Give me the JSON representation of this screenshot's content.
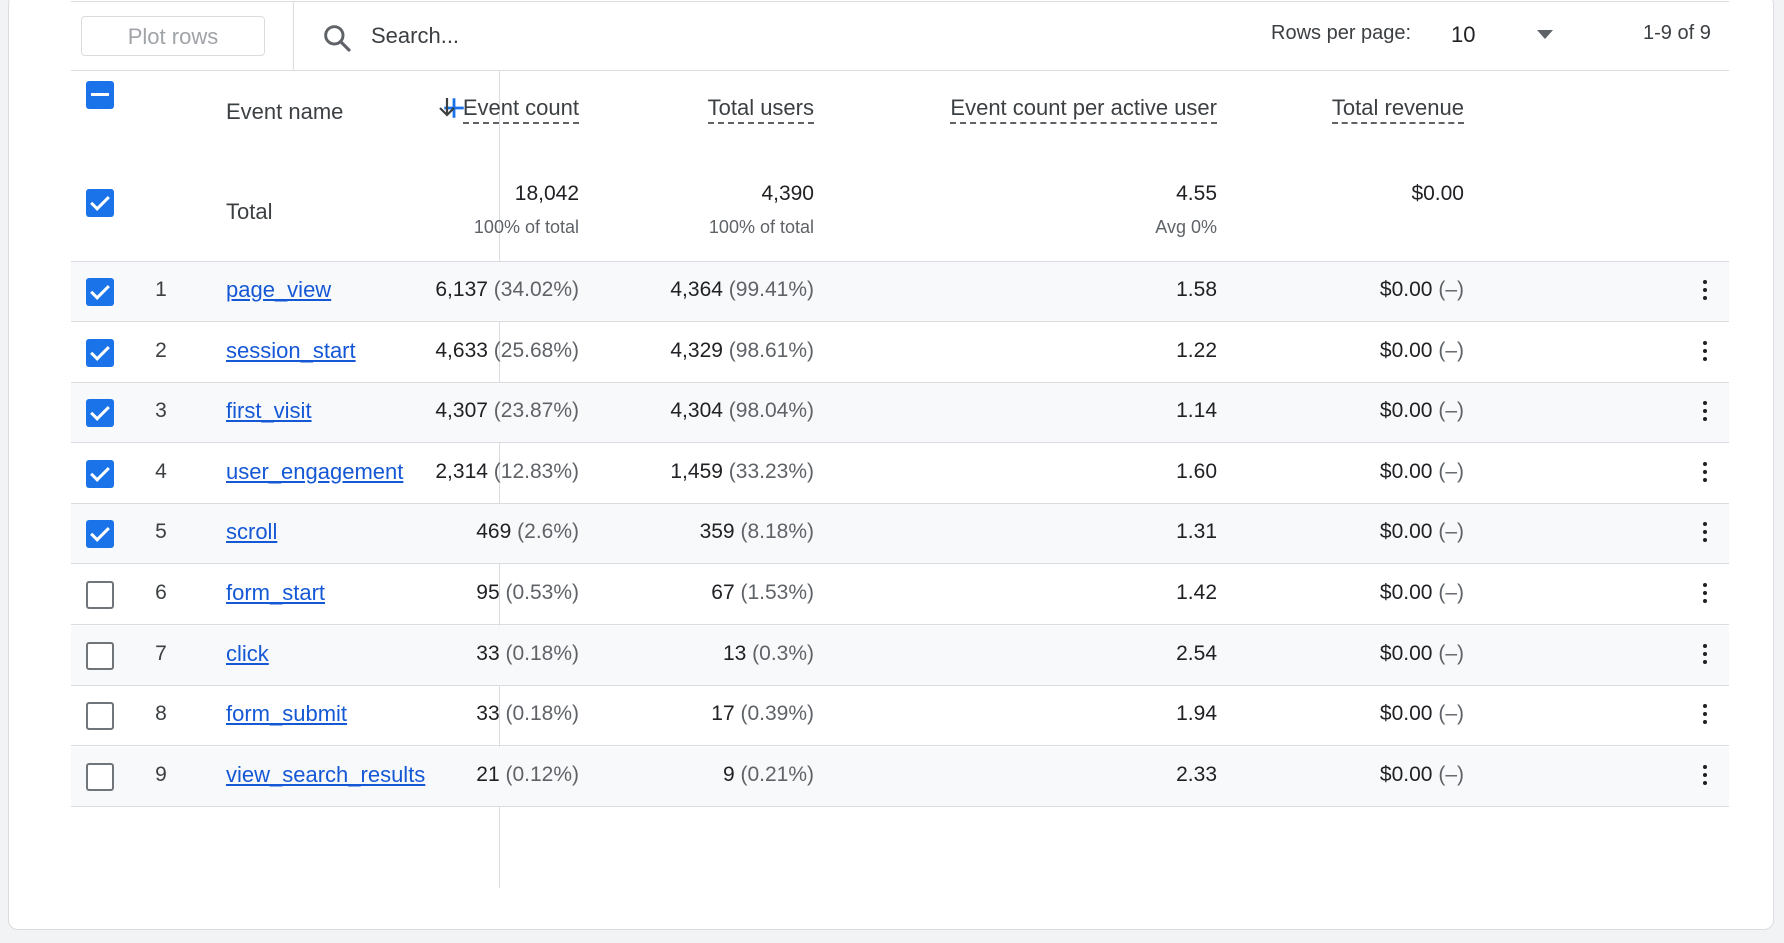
{
  "toolbar": {
    "plot_rows_label": "Plot rows",
    "search_placeholder": "Search...",
    "rows_per_page_label": "Rows per page:",
    "rows_per_page_value": "10",
    "pagination_text": "1-9 of 9"
  },
  "table": {
    "header": {
      "event_name": "Event name",
      "event_count": "Event count",
      "total_users": "Total users",
      "event_count_per_active_user": "Event count per active user",
      "total_revenue": "Total revenue"
    },
    "total": {
      "label": "Total",
      "event_count": "18,042",
      "event_count_sub": "100% of total",
      "total_users": "4,390",
      "total_users_sub": "100% of total",
      "event_count_per_active_user": "4.55",
      "event_count_per_active_user_sub": "Avg 0%",
      "total_revenue": "$0.00"
    },
    "rows": [
      {
        "index": "1",
        "name": "page_view",
        "checked": true,
        "event_count": "6,137",
        "event_count_pct": "(34.02%)",
        "total_users": "4,364",
        "total_users_pct": "(99.41%)",
        "epu": "1.58",
        "revenue": "$0.00",
        "revenue_pct": "(–)"
      },
      {
        "index": "2",
        "name": "session_start",
        "checked": true,
        "event_count": "4,633",
        "event_count_pct": "(25.68%)",
        "total_users": "4,329",
        "total_users_pct": "(98.61%)",
        "epu": "1.22",
        "revenue": "$0.00",
        "revenue_pct": "(–)"
      },
      {
        "index": "3",
        "name": "first_visit",
        "checked": true,
        "event_count": "4,307",
        "event_count_pct": "(23.87%)",
        "total_users": "4,304",
        "total_users_pct": "(98.04%)",
        "epu": "1.14",
        "revenue": "$0.00",
        "revenue_pct": "(–)"
      },
      {
        "index": "4",
        "name": "user_engagement",
        "checked": true,
        "event_count": "2,314",
        "event_count_pct": "(12.83%)",
        "total_users": "1,459",
        "total_users_pct": "(33.23%)",
        "epu": "1.60",
        "revenue": "$0.00",
        "revenue_pct": "(–)"
      },
      {
        "index": "5",
        "name": "scroll",
        "checked": true,
        "event_count": "469",
        "event_count_pct": "(2.6%)",
        "total_users": "359",
        "total_users_pct": "(8.18%)",
        "epu": "1.31",
        "revenue": "$0.00",
        "revenue_pct": "(–)"
      },
      {
        "index": "6",
        "name": "form_start",
        "checked": false,
        "event_count": "95",
        "event_count_pct": "(0.53%)",
        "total_users": "67",
        "total_users_pct": "(1.53%)",
        "epu": "1.42",
        "revenue": "$0.00",
        "revenue_pct": "(–)"
      },
      {
        "index": "7",
        "name": "click",
        "checked": false,
        "event_count": "33",
        "event_count_pct": "(0.18%)",
        "total_users": "13",
        "total_users_pct": "(0.3%)",
        "epu": "2.54",
        "revenue": "$0.00",
        "revenue_pct": "(–)"
      },
      {
        "index": "8",
        "name": "form_submit",
        "checked": false,
        "event_count": "33",
        "event_count_pct": "(0.18%)",
        "total_users": "17",
        "total_users_pct": "(0.39%)",
        "epu": "1.94",
        "revenue": "$0.00",
        "revenue_pct": "(–)"
      },
      {
        "index": "9",
        "name": "view_search_results",
        "checked": false,
        "event_count": "21",
        "event_count_pct": "(0.12%)",
        "total_users": "9",
        "total_users_pct": "(0.21%)",
        "epu": "2.33",
        "revenue": "$0.00",
        "revenue_pct": "(–)"
      }
    ]
  },
  "colors": {
    "accent": "#1a73e8",
    "link": "#1558d6",
    "divider": "#dadce0",
    "alt_row": "#f8f9fa"
  },
  "icons": {
    "search": "search-icon",
    "add": "plus-icon",
    "sort": "arrow-down-icon",
    "dropdown": "caret-down-icon",
    "row_menu": "more-vertical-icon"
  }
}
